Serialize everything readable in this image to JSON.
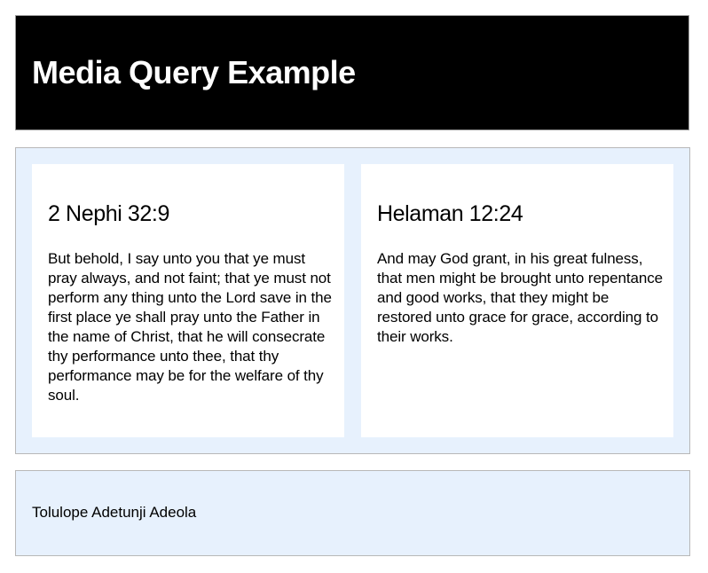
{
  "header": {
    "title": "Media Query Example"
  },
  "cards": [
    {
      "title": "2 Nephi 32:9",
      "body": "But behold, I say unto you that ye must pray always, and not faint; that ye must not perform any thing unto the Lord save in the first place ye shall pray unto the Father in the name of Christ, that he will consecrate thy performance unto thee, that thy performance may be for the welfare of thy soul."
    },
    {
      "title": "Helaman 12:24",
      "body": "And may God grant, in his great fulness, that men might be brought unto repentance and good works, that they might be restored unto grace for grace, according to their works."
    }
  ],
  "footer": {
    "author": "Tolulope Adetunji Adeola"
  },
  "colors": {
    "header_background": "#000000",
    "header_text": "#ffffff",
    "panel_background": "#e7f1fd",
    "card_background": "#ffffff"
  }
}
